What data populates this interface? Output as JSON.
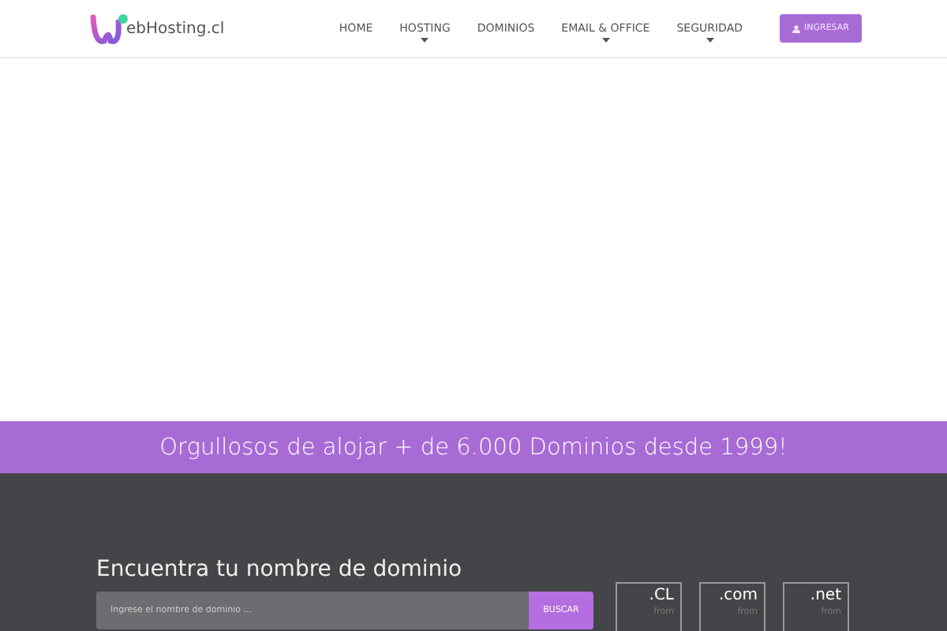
{
  "logo": {
    "text": "ebHosting.cl"
  },
  "nav": [
    {
      "label": "HOME",
      "dropdown": false
    },
    {
      "label": "HOSTING",
      "dropdown": true
    },
    {
      "label": "DOMINIOS",
      "dropdown": false
    },
    {
      "label": "EMAIL & OFFICE",
      "dropdown": true
    },
    {
      "label": "SEGURIDAD",
      "dropdown": true
    }
  ],
  "login_button": "INGRESAR",
  "banner": "Orgullosos de alojar + de 6.000 Dominios desde 1999!",
  "domain_search": {
    "title": "Encuentra tu nombre de dominio",
    "placeholder": "Ingrese el nombre de dominio ...",
    "button": "BUSCAR"
  },
  "tlds": [
    {
      "name": ".CL",
      "from": "from"
    },
    {
      "name": ".com",
      "from": "from"
    },
    {
      "name": ".net",
      "from": "from"
    }
  ]
}
